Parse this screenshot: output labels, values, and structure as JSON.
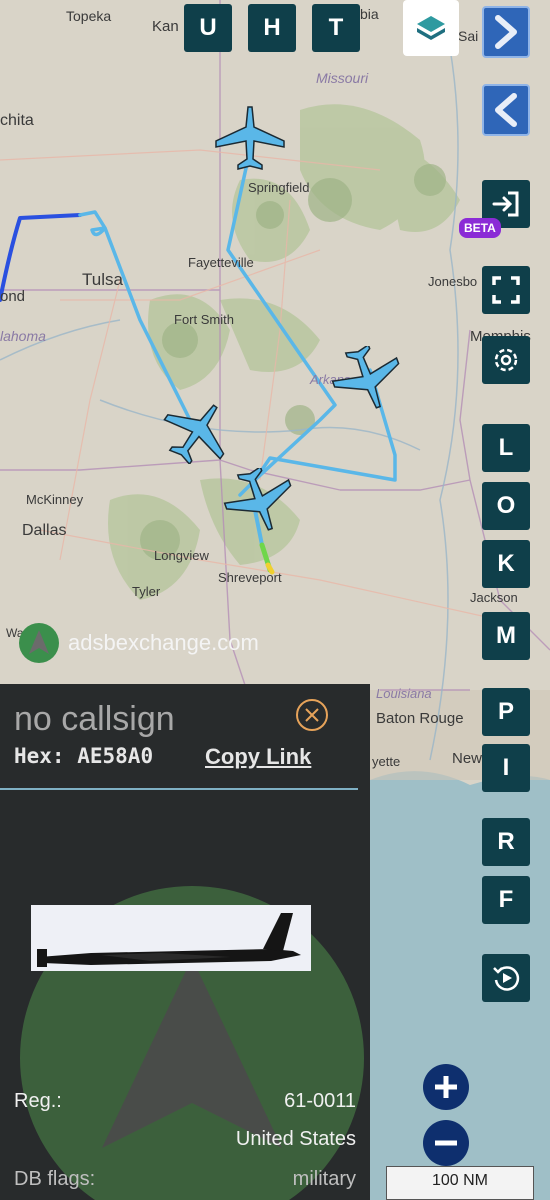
{
  "colors": {
    "button_bg": "#0f3f4a",
    "nav_bg": "#2f66b8",
    "beta_bg": "#8b2bd6",
    "panel_bg": "#282b2c",
    "track_light": "#5ab7e8",
    "track_dark": "#2a50e0",
    "aircraft": "#5ab7e8",
    "zoom_bg": "#0e2f6e",
    "close_ring": "#e6a35a"
  },
  "top_buttons": {
    "u": "U",
    "h": "H",
    "t": "T"
  },
  "side_buttons": {
    "beta_label": "BETA",
    "l": "L",
    "o": "O",
    "k": "K",
    "m": "M",
    "p": "P",
    "i": "I",
    "r": "R",
    "f": "F"
  },
  "icons": {
    "layers": "layers-icon",
    "forward": "chevron-right-icon",
    "back": "chevron-left-icon",
    "login": "sign-in-icon",
    "fullscreen": "fullscreen-icon",
    "settings": "gear-icon",
    "replay": "replay-icon",
    "zoom_in": "plus-icon",
    "zoom_out": "minus-icon",
    "close": "close-icon"
  },
  "map_labels": {
    "topeka": "Topeka",
    "kansas_city": "Kan",
    "columbia": "bia",
    "st_louis": "Sai",
    "wichita": "chita",
    "missouri": "Missouri",
    "springfield": "Springfield",
    "fayetteville": "Fayetteville",
    "tulsa": "Tulsa",
    "oklahoma_city": "ond",
    "oklahoma": "lahoma",
    "jonesboro": "Jonesbo",
    "fort_smith": "Fort Smith",
    "memphis": "Memphis",
    "arkansas": "Arkans",
    "mckinney": "McKinney",
    "dallas": "Dallas",
    "longview": "Longview",
    "tyler": "Tyler",
    "shreveport": "Shreveport",
    "jackson": "Jackson",
    "waco": "Waco",
    "louisiana": "Louisiana",
    "baton_rouge": "Baton Rouge",
    "lafayette": "yette",
    "new_orleans": "New"
  },
  "attribution": "adsbexchange.com",
  "panel": {
    "callsign": "no callsign",
    "hex_label": "Hex:",
    "hex_value": "AE58A0",
    "copy_link": "Copy Link",
    "reg_label": "Reg.:",
    "reg_value": "61-0011",
    "country": "United States",
    "db_flags_label": "DB flags:",
    "db_flags_value": "military"
  },
  "scale_text": "100 NM"
}
